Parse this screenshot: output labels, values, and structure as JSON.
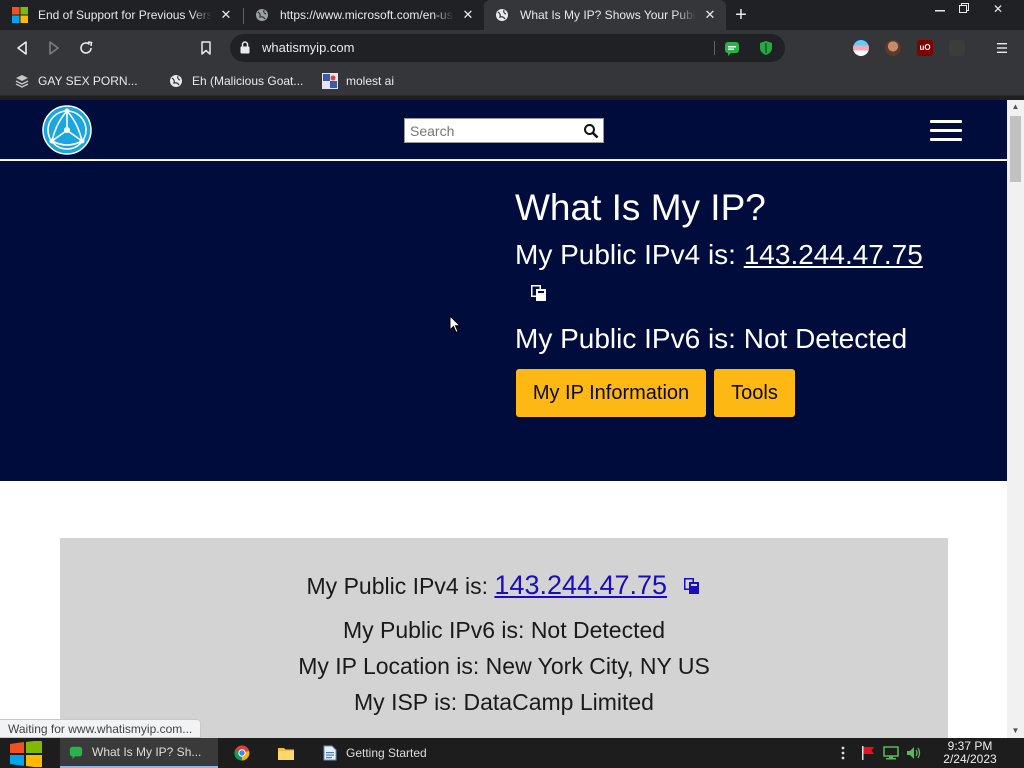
{
  "browser": {
    "tabs": [
      {
        "title": "End of Support for Previous Versions",
        "favicon": "microsoft-logo"
      },
      {
        "title": "https://www.microsoft.com/en-us/sc",
        "favicon": "globe-icon"
      },
      {
        "title": "What Is My IP? Shows Your Public IP",
        "favicon": "globe-icon",
        "active": true
      }
    ],
    "address": "whatismyip.com",
    "bookmarks": [
      {
        "label": "GAY SEX PORN...",
        "icon": "bookmark-site-icon"
      },
      {
        "label": "Eh (Malicious Goat...",
        "icon": "globe-icon"
      },
      {
        "label": "molest ai",
        "icon": "bookmark-site-icon"
      }
    ],
    "status_text": "Waiting for www.whatismyip.com..."
  },
  "site": {
    "search_placeholder": "Search",
    "hero": {
      "title": "What Is My IP?",
      "ipv4_prefix": "My Public IPv4 is:",
      "ipv4_value": "143.244.47.75",
      "ipv6_line": "My Public IPv6 is: Not Detected",
      "buttons": [
        "My IP Information",
        "Tools"
      ]
    },
    "panel": {
      "ipv4_prefix": "My Public IPv4 is:",
      "ipv4_value": "143.244.47.75",
      "ipv6_line": "My Public IPv6 is: Not Detected",
      "location_line": "My IP Location is: New York City, NY US",
      "isp_line": "My ISP is: DataCamp Limited"
    }
  },
  "taskbar": {
    "items": [
      {
        "label": "What Is My IP? Sh...",
        "active": true
      },
      {
        "label": "",
        "icon": "chrome-icon"
      },
      {
        "label": "",
        "icon": "folder-icon"
      },
      {
        "label": "Getting Started"
      }
    ],
    "time": "9:37 PM",
    "date": "2/24/2023"
  },
  "colors": {
    "site_navy": "#000c3c",
    "button_yellow": "#fdb813",
    "panel_gray": "#d3d3d3",
    "link_blue": "#1a0dbd"
  }
}
